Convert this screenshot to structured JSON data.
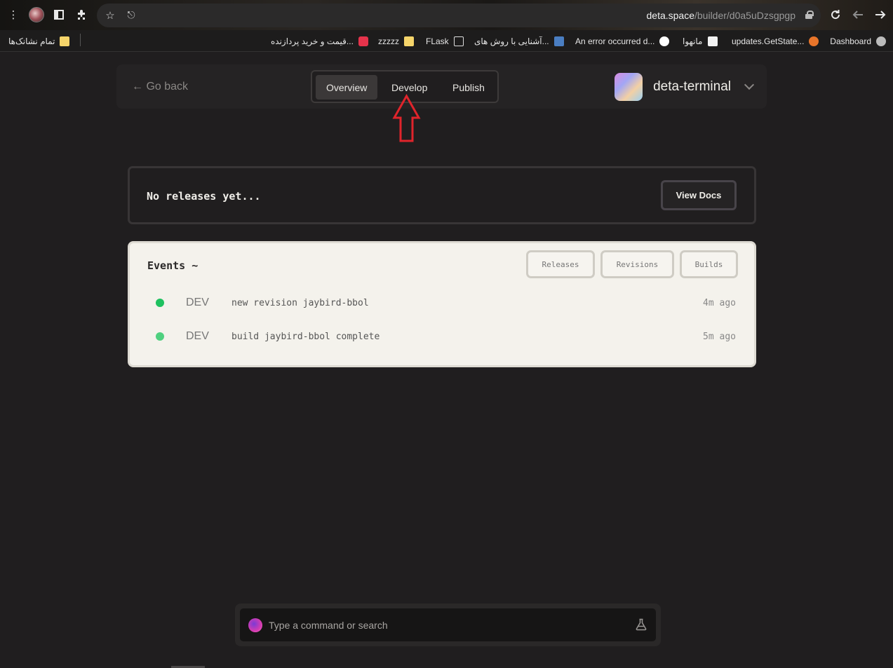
{
  "browser": {
    "url_host": "deta.space",
    "url_path": "/builder/d0a5uDzsgpgp",
    "icons": [
      "menu-icon",
      "profile-icon",
      "sidebar-icon",
      "extensions-icon",
      "star-icon",
      "share-icon",
      "lock-icon",
      "reload-icon",
      "back-icon",
      "forward-icon"
    ]
  },
  "bookmarks": {
    "items": [
      {
        "label": "Dashboard",
        "icon_color": "#bbbbbb"
      },
      {
        "label": "updates.GetState...",
        "icon_color": "#e8752a"
      },
      {
        "label": "مانهوا",
        "icon_color": "#f2f2f2"
      },
      {
        "label": "An error occurred d...",
        "icon_color": "#ffffff"
      },
      {
        "label": "آشنایی با روش های...",
        "icon_color": "#4a7ec2"
      },
      {
        "label": "FLask",
        "icon_color": "#222222"
      },
      {
        "label": "zzzzz",
        "icon_color": "#f5d46a"
      },
      {
        "label": "قیمت و خرید پردازنده...",
        "icon_color": "#e5334b"
      },
      {
        "label": "تمام نشانک‌ها",
        "icon_color": "#f5d46a"
      }
    ]
  },
  "header": {
    "go_back": "← Go back",
    "tabs": [
      {
        "label": "Overview",
        "active": true
      },
      {
        "label": "Develop",
        "active": false
      },
      {
        "label": "Publish",
        "active": false
      }
    ],
    "project_name": "deta-terminal"
  },
  "releases": {
    "empty_text": "No releases yet...",
    "view_docs": "View Docs"
  },
  "events": {
    "title": "Events ~",
    "filters": [
      "Releases",
      "Revisions",
      "Builds"
    ],
    "rows": [
      {
        "env": "DEV",
        "message": "new revision jaybird-bbol",
        "time": "4m ago",
        "status_color": "#1ec15f"
      },
      {
        "env": "DEV",
        "message": "build jaybird-bbol complete",
        "time": "5m ago",
        "status_color": "#4fd07f"
      }
    ]
  },
  "command_bar": {
    "placeholder": "Type a command or search"
  },
  "annotation": {
    "arrow_color": "#e0242b"
  }
}
